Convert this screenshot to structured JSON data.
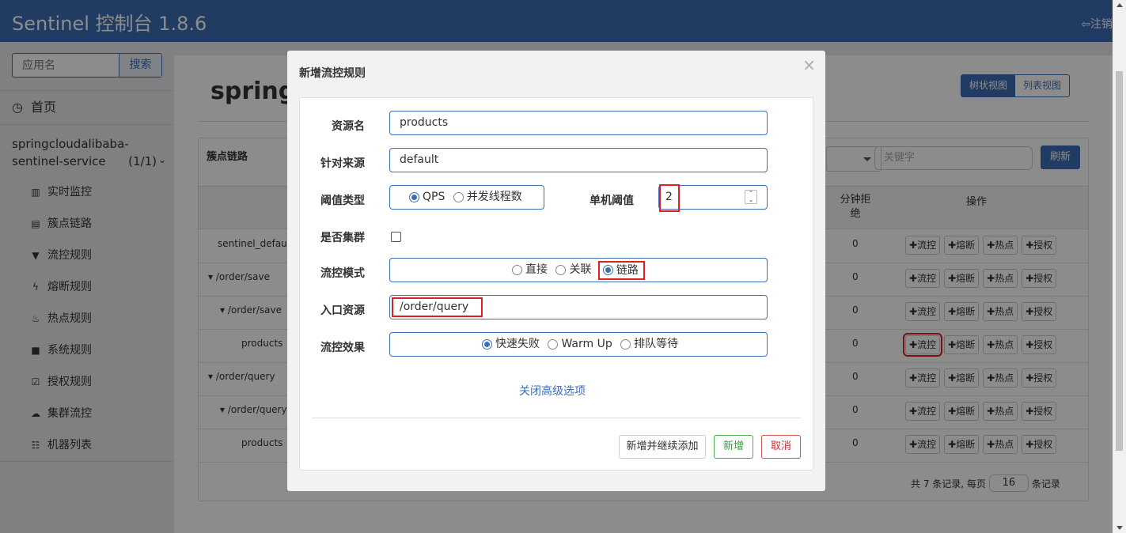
{
  "header": {
    "brand": "Sentinel 控制台 1.8.6",
    "logout": "注销"
  },
  "sidebar": {
    "search_placeholder": "应用名",
    "search_button": "搜索",
    "home": "首页",
    "app_name": "springcloudalibaba-sentinel-service",
    "app_count": "(1/1)",
    "items": [
      {
        "label": "实时监控",
        "icon": "bar-chart-icon"
      },
      {
        "label": "簇点链路",
        "icon": "list-icon"
      },
      {
        "label": "流控规则",
        "icon": "filter-icon"
      },
      {
        "label": "熔断规则",
        "icon": "bolt-icon"
      },
      {
        "label": "热点规则",
        "icon": "fire-icon"
      },
      {
        "label": "系统规则",
        "icon": "lock-icon"
      },
      {
        "label": "授权规则",
        "icon": "check-square-icon"
      },
      {
        "label": "集群流控",
        "icon": "cloud-icon"
      },
      {
        "label": "机器列表",
        "icon": "th-list-icon"
      }
    ]
  },
  "main": {
    "title": "springc",
    "view_tree": "树状视图",
    "view_list": "列表视图",
    "panel_title": "簇点链路",
    "keyword_placeholder": "关键字",
    "refresh": "刷新",
    "col_min_reject": "分钟拒绝",
    "col_ops": "操作",
    "rows": [
      {
        "name": "sentinel_default",
        "min": "0"
      },
      {
        "name": "▾ /order/save",
        "min": "0"
      },
      {
        "name": "▾ /order/save",
        "min": "0"
      },
      {
        "name": "products",
        "min": "0"
      },
      {
        "name": "▾ /order/query",
        "min": "0"
      },
      {
        "name": "▾ /order/query",
        "min": "0"
      },
      {
        "name": "products",
        "min": "0"
      }
    ],
    "ops": {
      "flow": "流控",
      "degrade": "熔断",
      "hot": "热点",
      "auth": "授权"
    },
    "pager": {
      "prefix": "共 7 条记录, 每页",
      "per_page": "16",
      "suffix": "条记录"
    }
  },
  "modal": {
    "title": "新增流控规则",
    "close": "×",
    "resource_label": "资源名",
    "resource_value": "products",
    "source_label": "针对来源",
    "source_value": "default",
    "threshold_type_label": "阈值类型",
    "threshold_types": [
      "QPS",
      "并发线程数"
    ],
    "single_threshold_label": "单机阈值",
    "single_threshold_value": "2",
    "cluster_label": "是否集群",
    "mode_label": "流控模式",
    "modes": [
      "直接",
      "关联",
      "链路"
    ],
    "entry_label": "入口资源",
    "entry_value": "/order/query",
    "effect_label": "流控效果",
    "effects": [
      "快速失败",
      "Warm Up",
      "排队等待"
    ],
    "advanced": "关闭高级选项",
    "btn_add_continue": "新增并继续添加",
    "btn_add": "新增",
    "btn_cancel": "取消"
  }
}
